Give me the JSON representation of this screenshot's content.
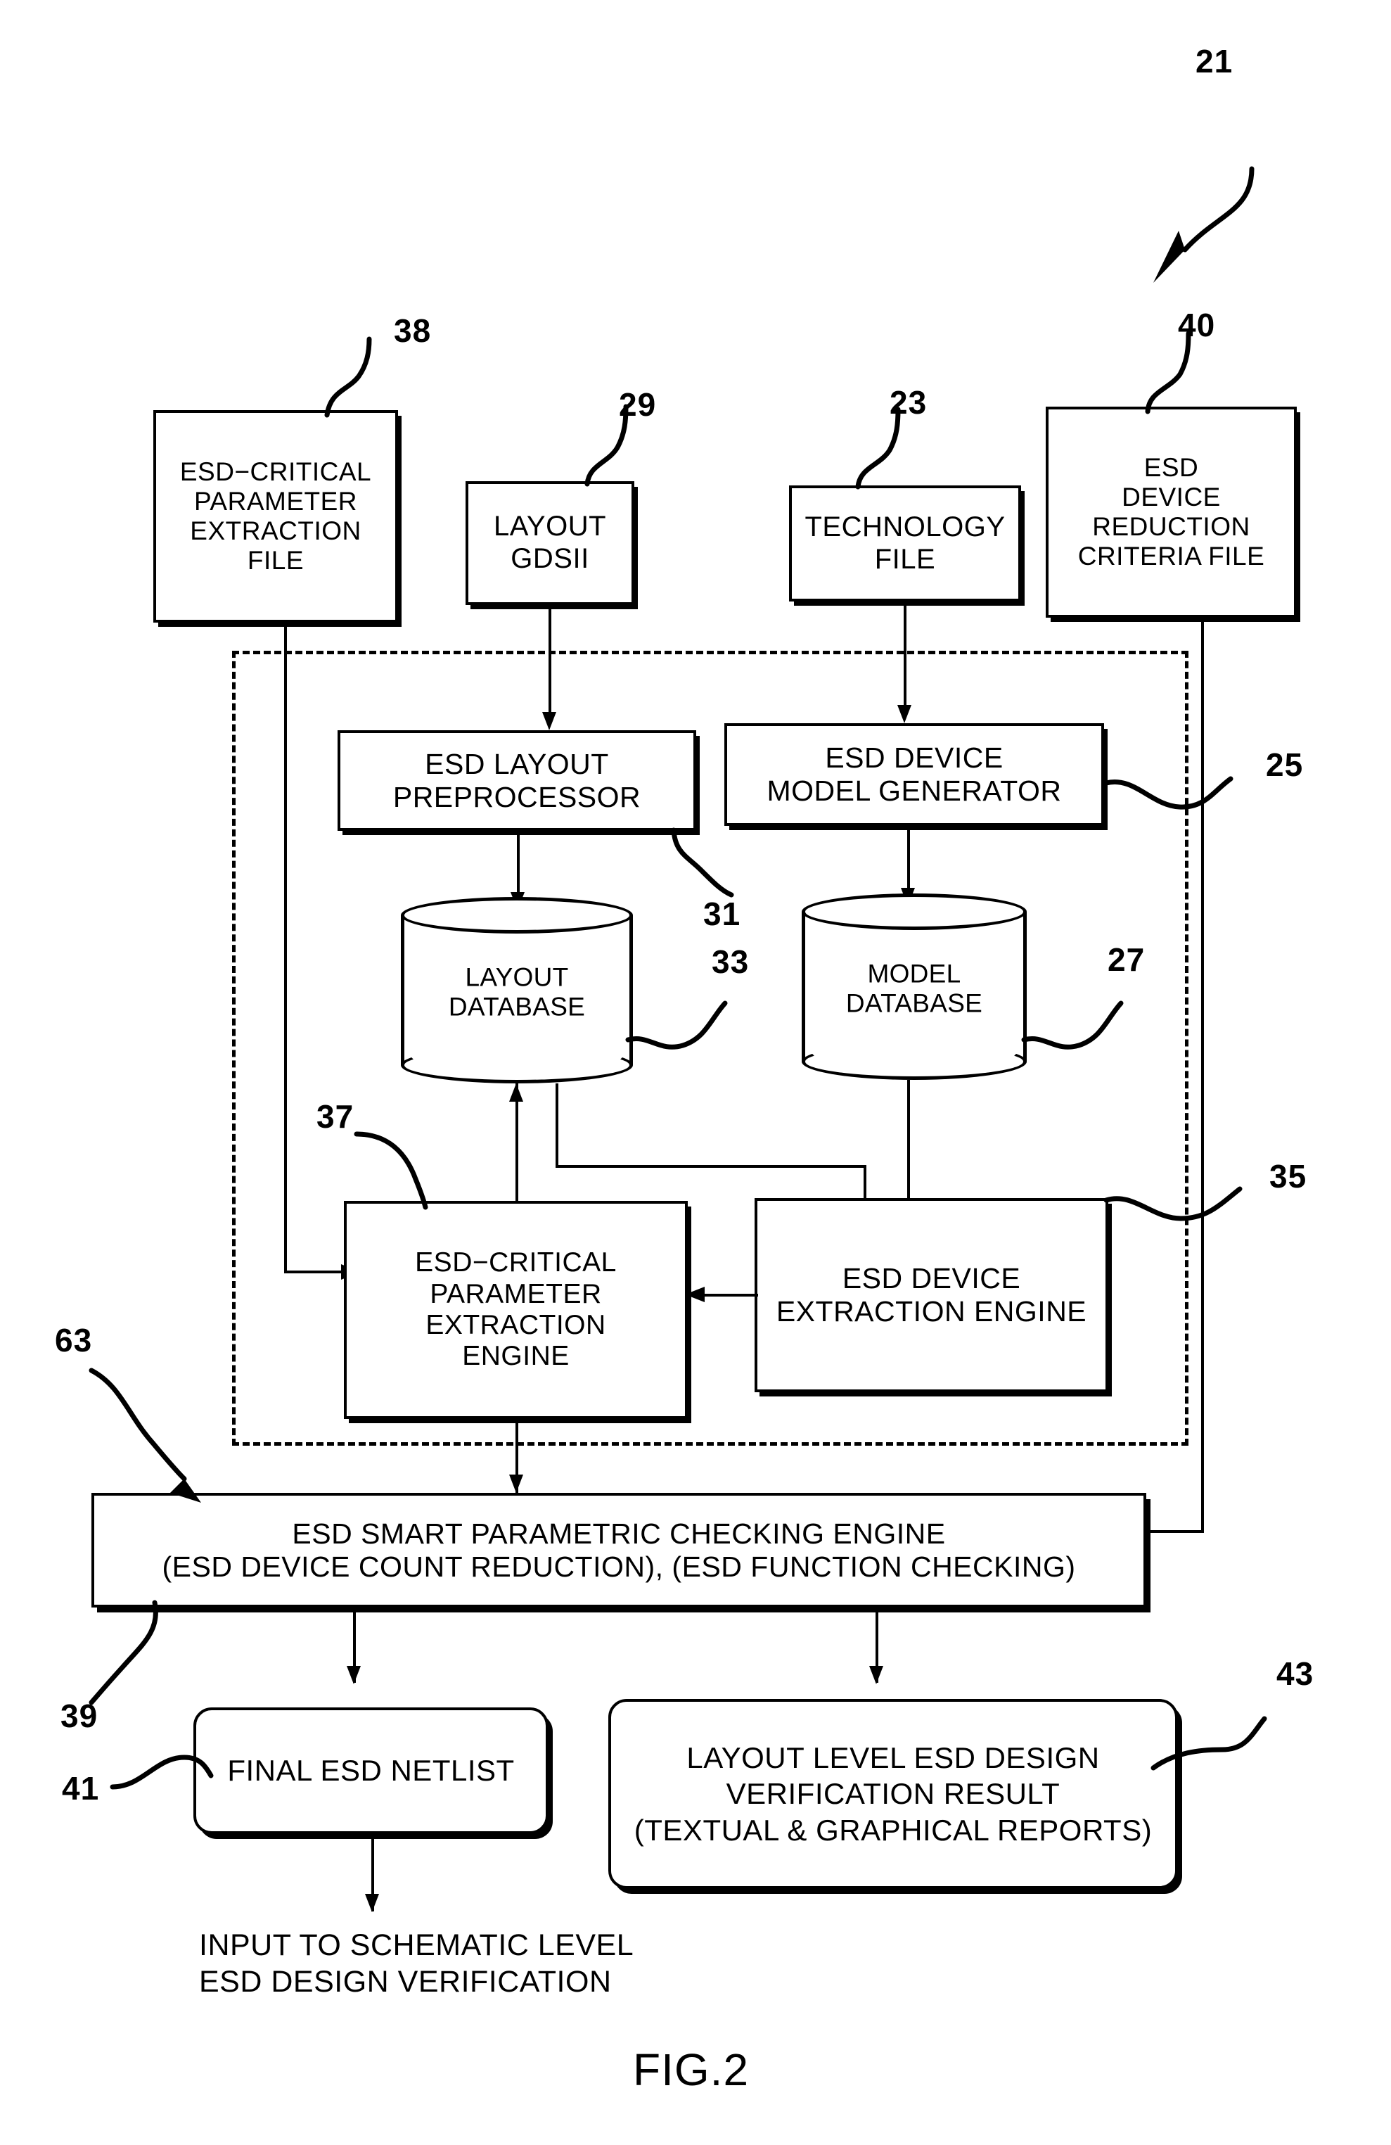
{
  "figure": {
    "label": "FIG.2",
    "system_ref": "21"
  },
  "input_files": [
    {
      "ref": "38",
      "name": "esd-critical-parameter-extraction-file",
      "lines": [
        "ESD−CRITICAL",
        "PARAMETER",
        "EXTRACTION",
        "FILE"
      ]
    },
    {
      "ref": "29",
      "name": "layout-gdsii-file",
      "lines": [
        "LAYOUT",
        "GDSII"
      ]
    },
    {
      "ref": "23",
      "name": "technology-file",
      "lines": [
        "TECHNOLOGY",
        "FILE"
      ]
    },
    {
      "ref": "40",
      "name": "esd-device-reduction-criteria-file",
      "lines": [
        "ESD",
        "DEVICE",
        "REDUCTION",
        "CRITERIA FILE"
      ]
    }
  ],
  "engine_group": {
    "ref": "25",
    "processors": [
      {
        "ref": "31",
        "name": "esd-layout-preprocessor",
        "lines": [
          "ESD LAYOUT",
          "PREPROCESSOR"
        ]
      },
      {
        "ref": "",
        "name": "esd-device-model-generator",
        "lines": [
          "ESD DEVICE",
          "MODEL GENERATOR"
        ]
      }
    ],
    "databases": [
      {
        "ref": "33",
        "name": "layout-database",
        "lines": [
          "LAYOUT",
          "DATABASE"
        ]
      },
      {
        "ref": "27",
        "name": "model-database",
        "lines": [
          "MODEL",
          "DATABASE"
        ]
      }
    ],
    "extraction_engines": [
      {
        "ref": "37",
        "name": "esd-critical-parameter-extraction-engine",
        "lines": [
          "ESD−CRITICAL",
          "PARAMETER",
          "EXTRACTION",
          "ENGINE"
        ]
      },
      {
        "ref": "35",
        "name": "esd-device-extraction-engine",
        "lines": [
          "ESD  DEVICE",
          "EXTRACTION ENGINE"
        ]
      }
    ]
  },
  "checking_engine": {
    "ref": "63",
    "ref_secondary": "39",
    "name": "esd-smart-parametric-checking-engine",
    "lines": [
      "ESD SMART PARAMETRIC CHECKING ENGINE",
      "(ESD DEVICE COUNT REDUCTION), (ESD FUNCTION CHECKING)"
    ]
  },
  "outputs": [
    {
      "ref": "41",
      "name": "final-esd-netlist",
      "lines": [
        "FINAL  ESD  NETLIST"
      ]
    },
    {
      "ref": "43",
      "name": "layout-level-esd-design-verification-result",
      "lines": [
        "LAYOUT LEVEL ESD DESIGN",
        "VERIFICATION RESULT",
        "(TEXTUAL & GRAPHICAL REPORTS)"
      ]
    }
  ],
  "footer_note": {
    "name": "input-to-schematic-level-note",
    "lines": [
      "INPUT TO SCHEMATIC LEVEL",
      "ESD DESIGN VERIFICATION"
    ]
  },
  "colors": {
    "ink": "#000000",
    "paper": "#ffffff"
  }
}
